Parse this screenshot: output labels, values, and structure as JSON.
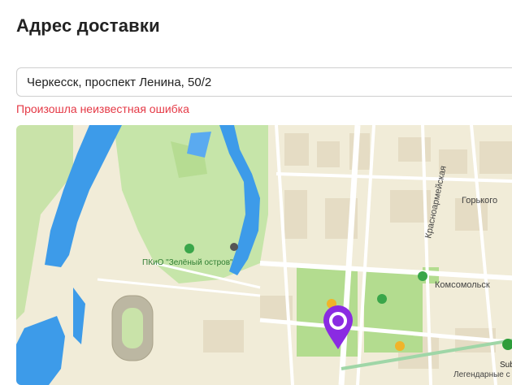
{
  "page": {
    "title": "Адрес доставки"
  },
  "address": {
    "value": "Черкесск, проспект Ленина, 50/2",
    "placeholder": ""
  },
  "error": {
    "message": "Произошла неизвестная ошибка"
  },
  "map": {
    "labels": {
      "park": "ПКиО \"Зелёный остров\"",
      "street_krasnoarmeyskaya": "Красноармейская",
      "street_gorkogo": "Горького",
      "street_komsomolskaya": "Комсомольск",
      "poi_sub": "Sub",
      "poi_legendary": "Легендарные с"
    },
    "colors": {
      "pin": "#8a2be2",
      "park": "#c6e5a9",
      "water": "#3d9be9",
      "error": "#e53946"
    }
  }
}
